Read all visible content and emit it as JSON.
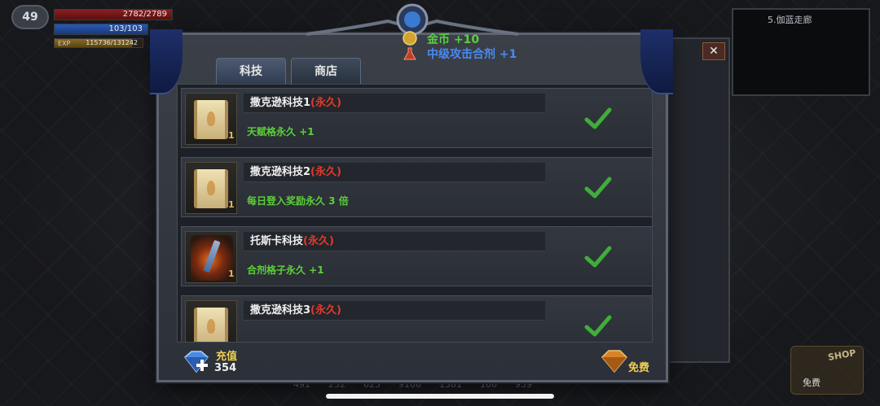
{
  "hud": {
    "level": "49",
    "hp": "2782/2789",
    "mp": "103/103",
    "exp_label": "EXP",
    "exp": "115736/131242",
    "exp_fraction": 0.88
  },
  "minimap": {
    "title": "5.伽蓝走廊"
  },
  "notifications": {
    "gold": "金币 +10",
    "item": "中级攻击合剂 +1"
  },
  "tabs": [
    {
      "label": "科技",
      "active": true
    },
    {
      "label": "商店",
      "active": false
    }
  ],
  "close_label": "✕",
  "rows": [
    {
      "name": "撒克逊科技1",
      "perm": "(永久)",
      "desc": "天赋格永久 +1",
      "badge": "1",
      "icon": "scroll-icon"
    },
    {
      "name": "撒克逊科技2",
      "perm": "(永久)",
      "desc": "每日登入奖励永久 3 倍",
      "badge": "1",
      "icon": "scroll-icon"
    },
    {
      "name": "托斯卡科技",
      "perm": "(永久)",
      "desc": "合剂格子永久 +1",
      "badge": "1",
      "icon": "sword-icon"
    },
    {
      "name": "撒克逊科技3",
      "perm": "(永久)",
      "desc": "",
      "badge": "",
      "icon": "scroll-icon"
    }
  ],
  "footer": {
    "recharge_label": "充值",
    "diamonds": "354",
    "free_label": "免费"
  },
  "shop": {
    "label": "SHOP",
    "free": "免费"
  },
  "bottom_strip": [
    "491",
    "252",
    "623",
    "9106",
    "1381",
    "106",
    "939"
  ],
  "colors": {
    "permanent": "#e03a2a",
    "desc": "#5ccf3a",
    "gold_text": "#f0d050",
    "check": "#3fae3a"
  }
}
